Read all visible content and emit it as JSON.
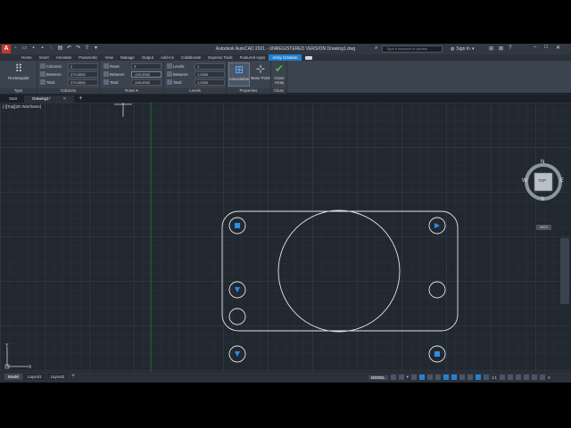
{
  "titlebar": {
    "logo": "A",
    "title": "Autodesk AutoCAD 2021 - UNREGISTERED VERSION    Drawing1.dwg",
    "search_placeholder": "Type a keyword or phrase",
    "signin": "Sign In"
  },
  "ribbon_tabs": [
    "Home",
    "Insert",
    "Annotate",
    "Parametric",
    "View",
    "Manage",
    "Output",
    "Add-ins",
    "Collaborate",
    "Express Tools",
    "Featured Apps",
    "Array Creation"
  ],
  "ribbon": {
    "type_panel": {
      "button_label": "Rectangular",
      "title": "Type"
    },
    "columns_panel": {
      "title": "Columns",
      "rows": [
        {
          "label": "Columns:",
          "value": "2"
        },
        {
          "label": "Between:",
          "value": "270.0000"
        },
        {
          "label": "Total:",
          "value": "270.0000"
        }
      ]
    },
    "rows_panel": {
      "title": "Rows",
      "rows": [
        {
          "label": "Rows:",
          "value": "3"
        },
        {
          "label": "Between:",
          "value": "-120.0000"
        },
        {
          "label": "Total:",
          "value": "-240.0000"
        }
      ]
    },
    "levels_panel": {
      "title": "Levels",
      "rows": [
        {
          "label": "Levels:",
          "value": "1"
        },
        {
          "label": "Between:",
          "value": "1.0000"
        },
        {
          "label": "Total:",
          "value": "1.0000"
        }
      ]
    },
    "properties_panel": {
      "title": "Properties",
      "associative": "Associative",
      "base_point": "Base Point"
    },
    "close_panel": {
      "title": "Close",
      "button_label": "Close Array"
    }
  },
  "doc_tabs": {
    "start": "Start",
    "drawing": "Drawing1*"
  },
  "canvas": {
    "view_label": "[-][Top][2D Wireframe]",
    "wcs": "WCS"
  },
  "viewcube": {
    "top": "TOP",
    "n": "N",
    "s": "S",
    "e": "E",
    "w": "W"
  },
  "layout_tabs": [
    "Model",
    "Layout1",
    "Layout2"
  ],
  "status": {
    "model": "MODEL",
    "scale": "1:1"
  },
  "colors": {
    "accent": "#1f7fd1",
    "canvas": "#212830",
    "ribbon": "#3b434e",
    "grip": "#2b8fe8"
  }
}
